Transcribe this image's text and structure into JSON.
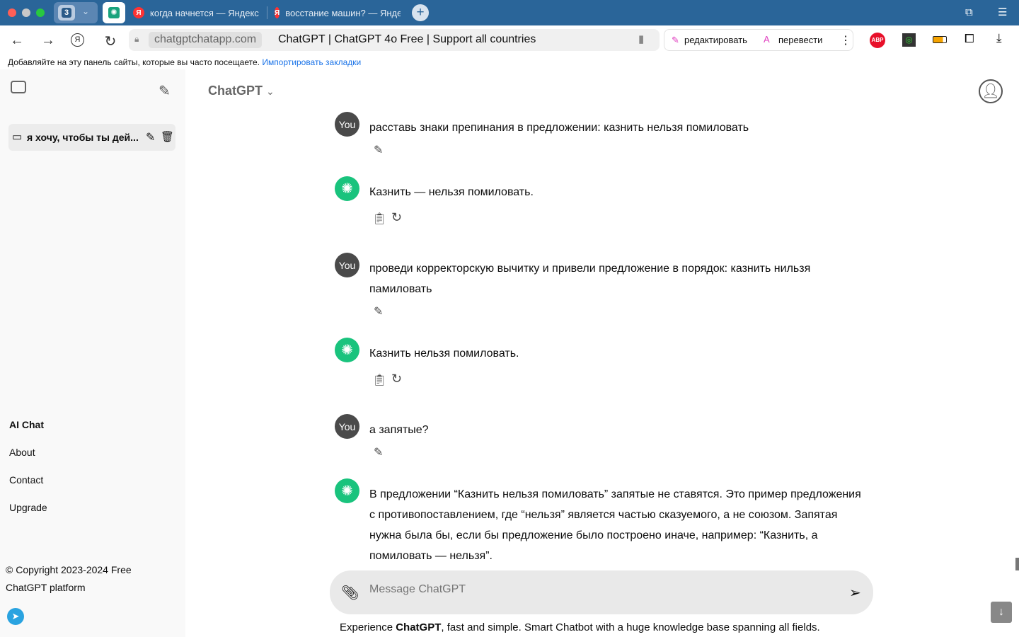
{
  "browser": {
    "tab_count_badge": "3",
    "tabs": [
      {
        "label": "когда начнется — Яндекс"
      },
      {
        "label": "восстание машин? — Яндекс"
      }
    ],
    "url_domain": "chatgptchatapp.com",
    "page_title": "ChatGPT | ChatGPT 4o Free | Support all countries",
    "edit_label": "редактировать",
    "translate_label": "перевести",
    "abp_label": "ABP",
    "bookmarks_hint": "Добавляйте на эту панель сайты, которые вы часто посещаете.",
    "import_bookmarks": "Импортировать закладки",
    "accent": "#2a6599"
  },
  "sidebar": {
    "chat_item": "я хочу, чтобы ты дей...",
    "links": [
      "AI Chat",
      "About",
      "Contact",
      "Upgrade"
    ],
    "copyright": "© Copyright 2023-2024 Free ChatGPT platform"
  },
  "header": {
    "model": "ChatGPT"
  },
  "messages": [
    {
      "role": "You",
      "text": "расставь знаки препинания в предложении: казнить нельзя помиловать"
    },
    {
      "role": "bot",
      "text": "Казнить — нельзя помиловать."
    },
    {
      "role": "You",
      "text": "проведи корректорскую вычитку и привели предложение в порядок: казнить нильзя памиловать"
    },
    {
      "role": "bot",
      "text": "Казнить нельзя помиловать."
    },
    {
      "role": "You",
      "text": "а запятые?"
    },
    {
      "role": "bot",
      "text": "В предложении “Казнить нельзя помиловать” запятые не ставятся. Это пример предложения с противопоставлением, где “нельзя” является частью сказуемого, а не союзом. Запятая нужна была бы, если бы предложение было построено иначе, например: “Казнить, а помиловать — нельзя”."
    }
  ],
  "composer": {
    "placeholder": "Message ChatGPT"
  },
  "footer": {
    "pre": "Experience ",
    "bold": "ChatGPT",
    "post": ", fast and simple. Smart Chatbot with a huge knowledge base spanning all fields."
  }
}
